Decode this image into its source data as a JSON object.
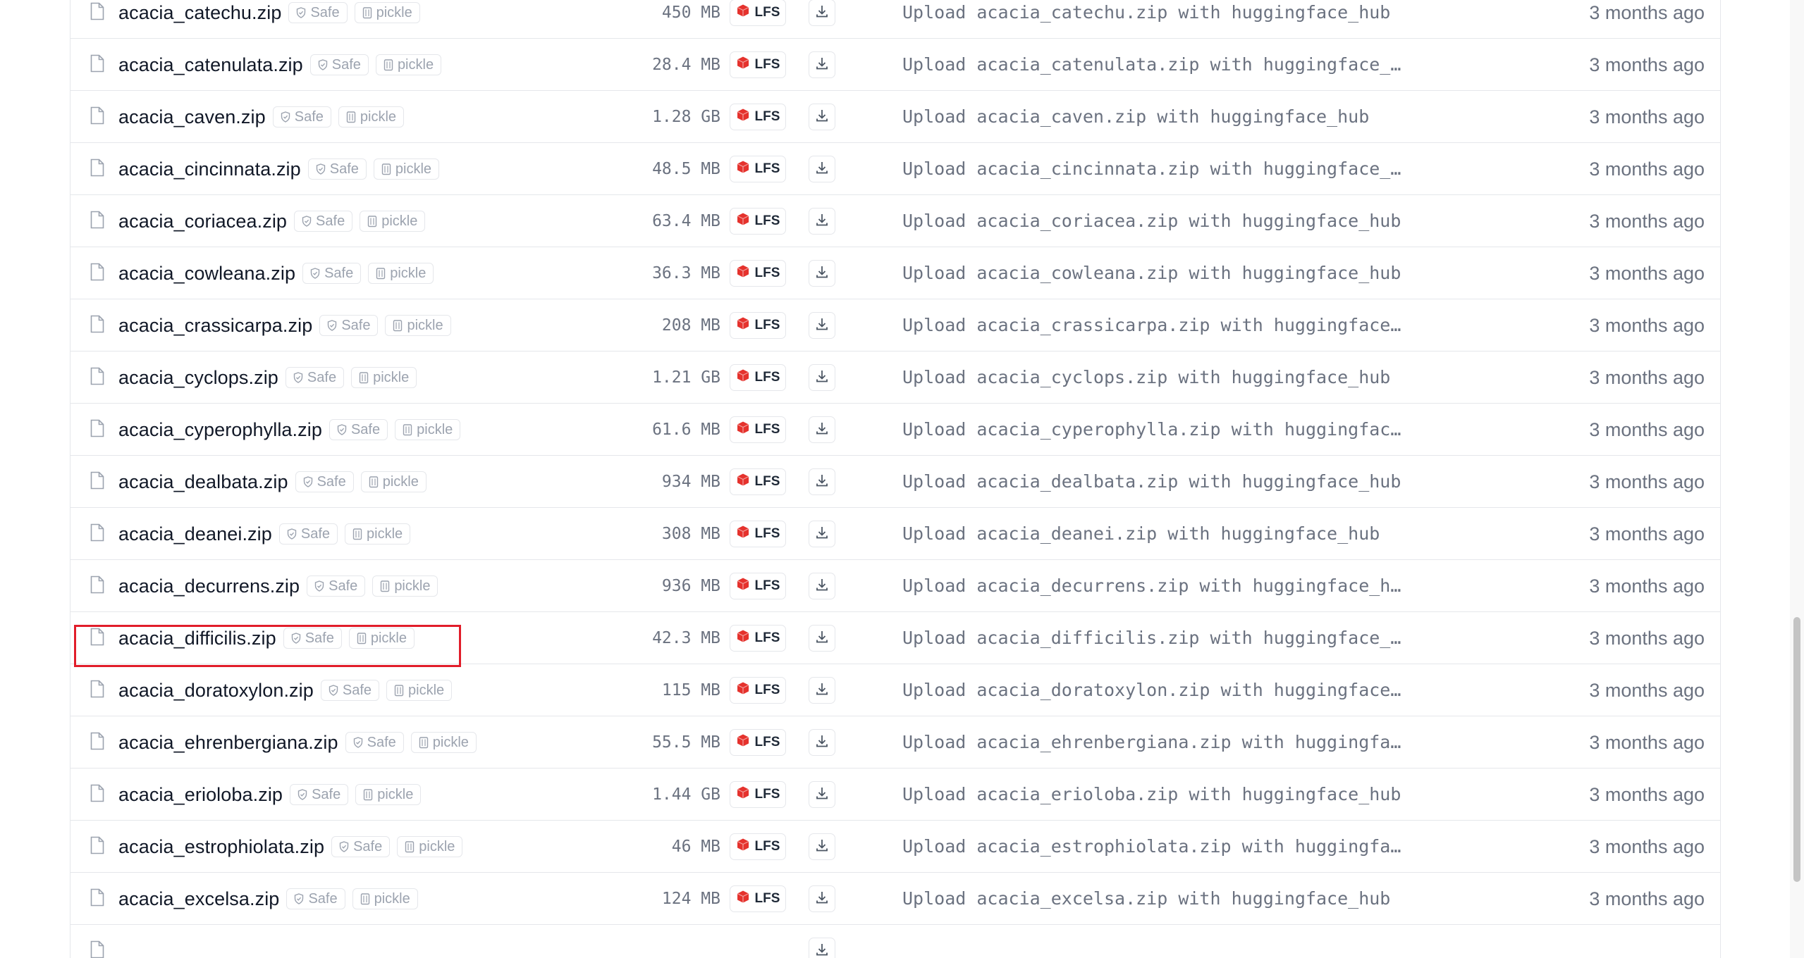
{
  "files": [
    {
      "name": "acacia_catechu.zip",
      "safe": "Safe",
      "format": "pickle",
      "size": "450 MB",
      "storage": "LFS",
      "commit": "Upload acacia_catechu.zip with huggingface_hub",
      "date": "3 months ago"
    },
    {
      "name": "acacia_catenulata.zip",
      "safe": "Safe",
      "format": "pickle",
      "size": "28.4 MB",
      "storage": "LFS",
      "commit": "Upload acacia_catenulata.zip with huggingface_…",
      "date": "3 months ago"
    },
    {
      "name": "acacia_caven.zip",
      "safe": "Safe",
      "format": "pickle",
      "size": "1.28 GB",
      "storage": "LFS",
      "commit": "Upload acacia_caven.zip with huggingface_hub",
      "date": "3 months ago"
    },
    {
      "name": "acacia_cincinnata.zip",
      "safe": "Safe",
      "format": "pickle",
      "size": "48.5 MB",
      "storage": "LFS",
      "commit": "Upload acacia_cincinnata.zip with huggingface_…",
      "date": "3 months ago"
    },
    {
      "name": "acacia_coriacea.zip",
      "safe": "Safe",
      "format": "pickle",
      "size": "63.4 MB",
      "storage": "LFS",
      "commit": "Upload acacia_coriacea.zip with huggingface_hub",
      "date": "3 months ago"
    },
    {
      "name": "acacia_cowleana.zip",
      "safe": "Safe",
      "format": "pickle",
      "size": "36.3 MB",
      "storage": "LFS",
      "commit": "Upload acacia_cowleana.zip with huggingface_hub",
      "date": "3 months ago"
    },
    {
      "name": "acacia_crassicarpa.zip",
      "safe": "Safe",
      "format": "pickle",
      "size": "208 MB",
      "storage": "LFS",
      "commit": "Upload acacia_crassicarpa.zip with huggingface…",
      "date": "3 months ago"
    },
    {
      "name": "acacia_cyclops.zip",
      "safe": "Safe",
      "format": "pickle",
      "size": "1.21 GB",
      "storage": "LFS",
      "commit": "Upload acacia_cyclops.zip with huggingface_hub",
      "date": "3 months ago"
    },
    {
      "name": "acacia_cyperophylla.zip",
      "safe": "Safe",
      "format": "pickle",
      "size": "61.6 MB",
      "storage": "LFS",
      "commit": "Upload acacia_cyperophylla.zip with huggingfac…",
      "date": "3 months ago"
    },
    {
      "name": "acacia_dealbata.zip",
      "safe": "Safe",
      "format": "pickle",
      "size": "934 MB",
      "storage": "LFS",
      "commit": "Upload acacia_dealbata.zip with huggingface_hub",
      "date": "3 months ago"
    },
    {
      "name": "acacia_deanei.zip",
      "safe": "Safe",
      "format": "pickle",
      "size": "308 MB",
      "storage": "LFS",
      "commit": "Upload acacia_deanei.zip with huggingface_hub",
      "date": "3 months ago"
    },
    {
      "name": "acacia_decurrens.zip",
      "safe": "Safe",
      "format": "pickle",
      "size": "936 MB",
      "storage": "LFS",
      "commit": "Upload acacia_decurrens.zip with huggingface_h…",
      "date": "3 months ago"
    },
    {
      "name": "acacia_difficilis.zip",
      "safe": "Safe",
      "format": "pickle",
      "size": "42.3 MB",
      "storage": "LFS",
      "commit": "Upload acacia_difficilis.zip with huggingface_…",
      "date": "3 months ago"
    },
    {
      "name": "acacia_doratoxylon.zip",
      "safe": "Safe",
      "format": "pickle",
      "size": "115 MB",
      "storage": "LFS",
      "commit": "Upload acacia_doratoxylon.zip with huggingface…",
      "date": "3 months ago"
    },
    {
      "name": "acacia_ehrenbergiana.zip",
      "safe": "Safe",
      "format": "pickle",
      "size": "55.5 MB",
      "storage": "LFS",
      "commit": "Upload acacia_ehrenbergiana.zip with huggingfa…",
      "date": "3 months ago"
    },
    {
      "name": "acacia_erioloba.zip",
      "safe": "Safe",
      "format": "pickle",
      "size": "1.44 GB",
      "storage": "LFS",
      "commit": "Upload acacia_erioloba.zip with huggingface_hub",
      "date": "3 months ago"
    },
    {
      "name": "acacia_estrophiolata.zip",
      "safe": "Safe",
      "format": "pickle",
      "size": "46 MB",
      "storage": "LFS",
      "commit": "Upload acacia_estrophiolata.zip with huggingfa…",
      "date": "3 months ago"
    },
    {
      "name": "acacia_excelsa.zip",
      "safe": "Safe",
      "format": "pickle",
      "size": "124 MB",
      "storage": "LFS",
      "commit": "Upload acacia_excelsa.zip with huggingface_hub",
      "date": "3 months ago"
    },
    {
      "name": "",
      "safe": "",
      "format": "",
      "size": "",
      "storage": "",
      "commit": "",
      "date": ""
    }
  ],
  "highlighted_file": "acacia_difficilis.zip",
  "colors": {
    "highlight_border": "#e11d2a",
    "lfs_icon": "#e5322d",
    "muted_text": "#6b7280",
    "border": "#e5e7eb"
  },
  "icons": {
    "file": "file-icon",
    "safe": "shield-check-icon",
    "pickle": "pickle-jar-icon",
    "lfs": "lfs-cube-icon",
    "download": "download-icon"
  }
}
